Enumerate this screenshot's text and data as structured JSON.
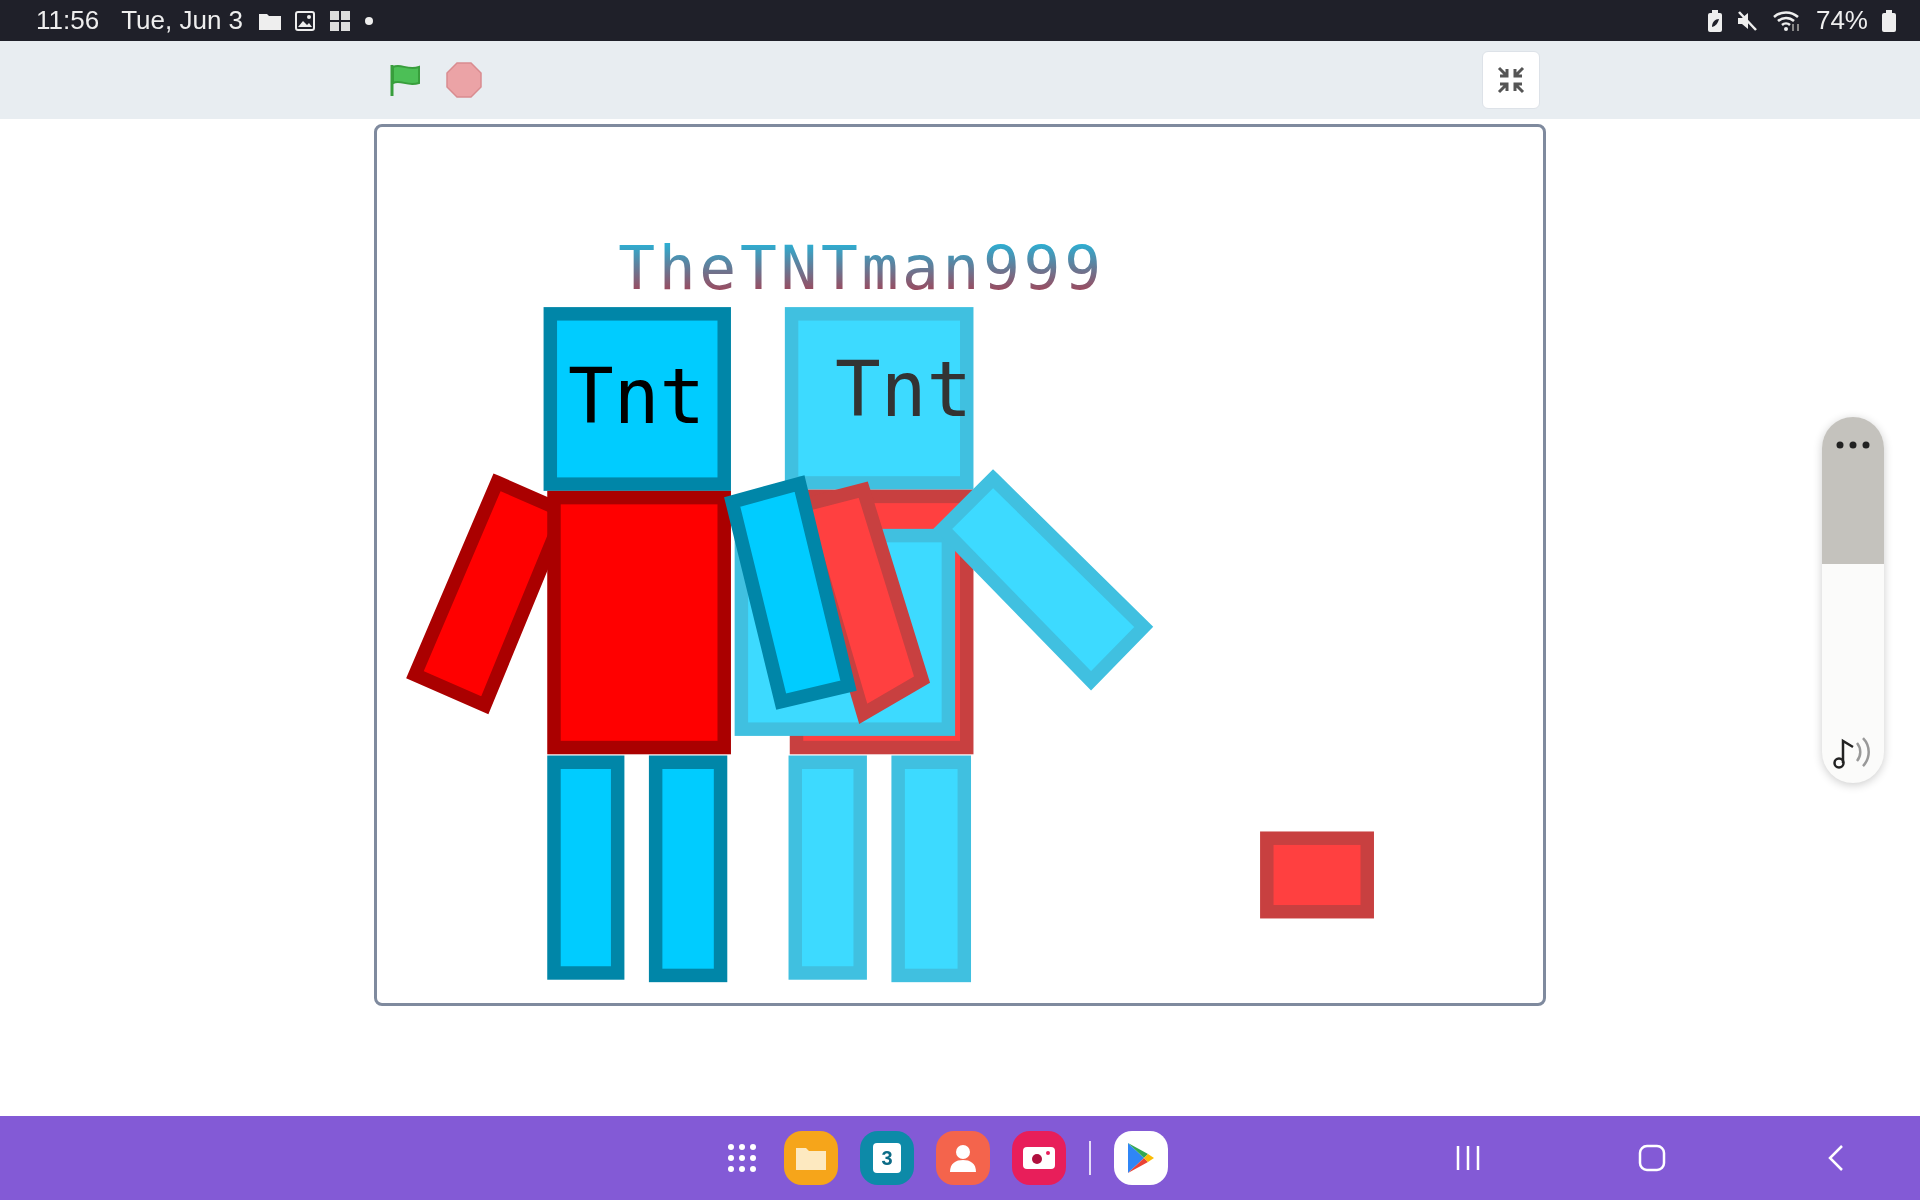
{
  "status_bar": {
    "time": "11:56",
    "date": "Tue, Jun 3",
    "battery": "74%"
  },
  "stage": {
    "title": "TheTNTman999",
    "head_labels": [
      "Tnt",
      "Tnt"
    ]
  },
  "taskbar": {
    "calendar_day": "3"
  }
}
